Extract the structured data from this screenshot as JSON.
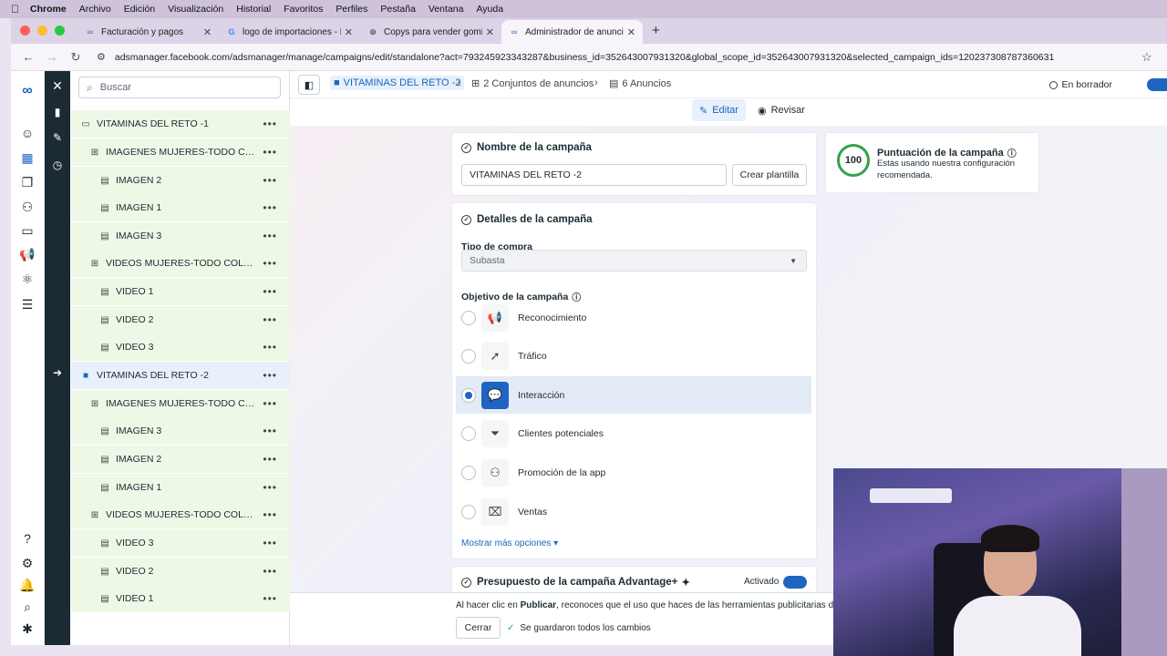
{
  "menubar": {
    "items": [
      "Chrome",
      "Archivo",
      "Edición",
      "Visualización",
      "Historial",
      "Favoritos",
      "Perfiles",
      "Pestaña",
      "Ventana",
      "Ayuda"
    ]
  },
  "tabs": [
    {
      "title": "Facturación y pagos",
      "icon": "meta-icon"
    },
    {
      "title": "logo de importaciones - Busc",
      "icon": "google-icon"
    },
    {
      "title": "Copys para vender gomitas",
      "icon": "openai-icon"
    },
    {
      "title": "Administrador de anuncios -",
      "icon": "meta-icon"
    }
  ],
  "address": {
    "url": "adsmanager.facebook.com/adsmanager/manage/campaigns/edit/standalone?act=793245923343287&business_id=352643007931320&global_scope_id=352643007931320&selected_campaign_ids=120237308787360631"
  },
  "tree": {
    "search_placeholder": "Buscar",
    "rows": [
      {
        "label": "VITAMINAS DEL RETO -1",
        "level": 0,
        "kind": "campaign"
      },
      {
        "label": "IMAGENES MUJERES-TODO COLO...",
        "level": 1,
        "kind": "adset"
      },
      {
        "label": "IMAGEN 2",
        "level": 2,
        "kind": "ad"
      },
      {
        "label": "IMAGEN 1",
        "level": 2,
        "kind": "ad"
      },
      {
        "label": "IMAGEN 3",
        "level": 2,
        "kind": "ad"
      },
      {
        "label": "VIDEOS MUJERES-TODO COLOMB...",
        "level": 1,
        "kind": "adset"
      },
      {
        "label": "VIDEO 1",
        "level": 2,
        "kind": "ad"
      },
      {
        "label": "VIDEO 2",
        "level": 2,
        "kind": "ad"
      },
      {
        "label": "VIDEO 3",
        "level": 2,
        "kind": "ad"
      },
      {
        "label": "VITAMINAS DEL RETO -2",
        "level": 0,
        "kind": "campaign-selected"
      },
      {
        "label": "IMAGENES MUJERES-TODO COLO...",
        "level": 1,
        "kind": "adset"
      },
      {
        "label": "IMAGEN 3",
        "level": 2,
        "kind": "ad"
      },
      {
        "label": "IMAGEN 2",
        "level": 2,
        "kind": "ad"
      },
      {
        "label": "IMAGEN 1",
        "level": 2,
        "kind": "ad"
      },
      {
        "label": "VIDEOS MUJERES-TODO COLOMB...",
        "level": 1,
        "kind": "adset"
      },
      {
        "label": "VIDEO 3",
        "level": 2,
        "kind": "ad"
      },
      {
        "label": "VIDEO 2",
        "level": 2,
        "kind": "ad"
      },
      {
        "label": "VIDEO 1",
        "level": 2,
        "kind": "ad"
      }
    ]
  },
  "breadcrumb": {
    "campaign": "VITAMINAS DEL RETO -2",
    "adsets": "2 Conjuntos de anuncios",
    "ads": "6 Anuncios"
  },
  "status": "En borrador",
  "modes": {
    "edit": "Editar",
    "review": "Revisar"
  },
  "campaign_name": {
    "title": "Nombre de la campaña",
    "value": "VITAMINAS DEL RETO -2",
    "template_button": "Crear plantilla"
  },
  "details": {
    "title": "Detalles de la campaña",
    "purchase_label": "Tipo de compra",
    "purchase_value": "Subasta",
    "objective_label": "Objetivo de la campaña",
    "objectives": [
      {
        "label": "Reconocimiento",
        "icon": "megaphone-icon",
        "selected": false
      },
      {
        "label": "Tráfico",
        "icon": "cursor-icon",
        "selected": false
      },
      {
        "label": "Interacción",
        "icon": "chat-bubbles-icon",
        "selected": true
      },
      {
        "label": "Clientes potenciales",
        "icon": "funnel-icon",
        "selected": false
      },
      {
        "label": "Promoción de la app",
        "icon": "people-icon",
        "selected": false
      },
      {
        "label": "Ventas",
        "icon": "briefcase-icon",
        "selected": false
      }
    ],
    "more_options": "Mostrar más opciones ▾"
  },
  "budget": {
    "title": "Presupuesto de la campaña Advantage+",
    "state": "Activado"
  },
  "score": {
    "value": "100",
    "title": "Puntuación de la campaña",
    "desc1": "Estás usando nuestra configuración",
    "desc2": "recomendada."
  },
  "footer": {
    "notice_prefix": "Al hacer clic en ",
    "notice_bold": "Publicar",
    "notice_suffix": ", reconoces que el uso que haces de las herramientas publicitarias de Meta",
    "close_button": "Cerrar",
    "saved_text": "Se guardaron todos los cambios"
  },
  "colors": {
    "accent": "#1d65c1",
    "dark_rail": "#1c2b33",
    "tree_bg": "#eef8e6",
    "success": "#31a24c"
  }
}
